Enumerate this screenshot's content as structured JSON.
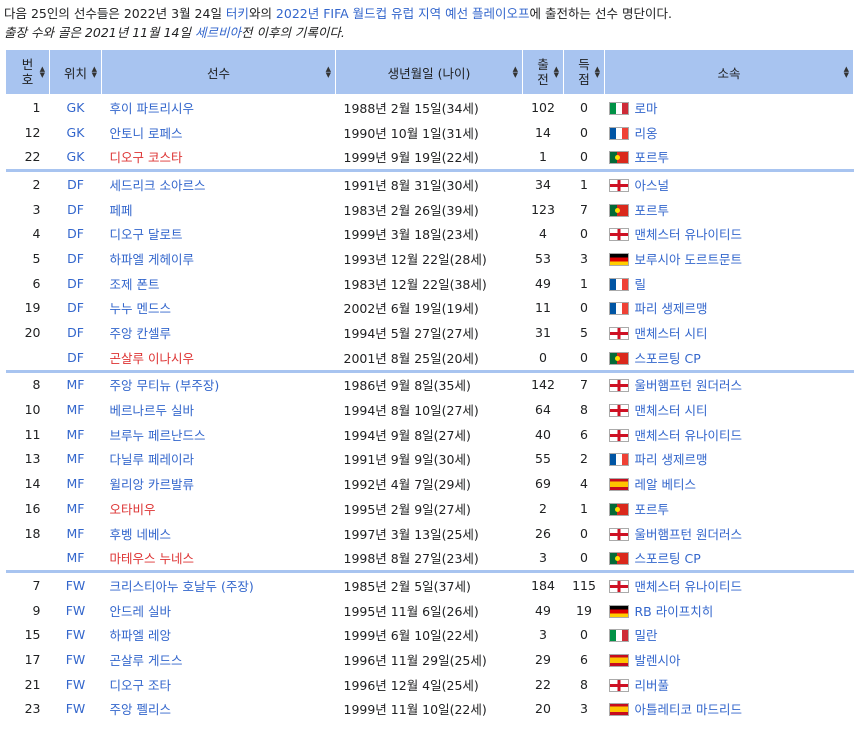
{
  "intro": {
    "p1_a": "다음 25인의 선수들은 2022년 3월 24일 ",
    "p1_link1": "터키",
    "p1_b": "와의 ",
    "p1_link2": "2022년 FIFA 월드컵 유럽 지역 예선 플레이오프",
    "p1_c": "에 출전하는 선수 명단이다.",
    "p2_a": "출장 수와 골은 2021년 11월 14일 ",
    "p2_link": "세르비아",
    "p2_b": "전 이후의 기록이다."
  },
  "headers": {
    "num": "번호",
    "pos": "위치",
    "player": "선수",
    "dob": "생년월일 (나이)",
    "caps": "출전",
    "goals": "득점",
    "club": "소속"
  },
  "icons": {
    "sort": "sort-icon",
    "flags": {
      "it": "italy-flag-icon",
      "fr": "france-flag-icon",
      "pt": "portugal-flag-icon",
      "en": "england-flag-icon",
      "de": "germany-flag-icon",
      "es": "spain-flag-icon"
    }
  },
  "colors": {
    "header_bg": "#a8c4f0",
    "link": "#3366cc",
    "redlink": "#dd3333"
  },
  "players": [
    {
      "num": "1",
      "pos": "GK",
      "name": "후이 파트리시우",
      "red": false,
      "dob": "1988년 2월 15일(34세)",
      "caps": "102",
      "goals": "0",
      "flag": "it",
      "club": "로마",
      "grp": true
    },
    {
      "num": "12",
      "pos": "GK",
      "name": "안토니 로페스",
      "red": false,
      "dob": "1990년 10월 1일(31세)",
      "caps": "14",
      "goals": "0",
      "flag": "fr",
      "club": "리옹",
      "grp": false
    },
    {
      "num": "22",
      "pos": "GK",
      "name": "디오구 코스타",
      "red": true,
      "dob": "1999년 9월 19일(22세)",
      "caps": "1",
      "goals": "0",
      "flag": "pt",
      "club": "포르투",
      "grp": false
    },
    {
      "num": "2",
      "pos": "DF",
      "name": "세드리크 소아르스",
      "red": false,
      "dob": "1991년 8월 31일(30세)",
      "caps": "34",
      "goals": "1",
      "flag": "en",
      "club": "아스널",
      "grp": true
    },
    {
      "num": "3",
      "pos": "DF",
      "name": "페페",
      "red": false,
      "dob": "1983년 2월 26일(39세)",
      "caps": "123",
      "goals": "7",
      "flag": "pt",
      "club": "포르투",
      "grp": false
    },
    {
      "num": "4",
      "pos": "DF",
      "name": "디오구 달로트",
      "red": false,
      "dob": "1999년 3월 18일(23세)",
      "caps": "4",
      "goals": "0",
      "flag": "en",
      "club": "맨체스터 유나이티드",
      "grp": false
    },
    {
      "num": "5",
      "pos": "DF",
      "name": "하파엘 게헤이루",
      "red": false,
      "dob": "1993년 12월 22일(28세)",
      "caps": "53",
      "goals": "3",
      "flag": "de",
      "club": "보루시아 도르트문트",
      "grp": false
    },
    {
      "num": "6",
      "pos": "DF",
      "name": "조제 폰트",
      "red": false,
      "dob": "1983년 12월 22일(38세)",
      "caps": "49",
      "goals": "1",
      "flag": "fr",
      "club": "릴",
      "grp": false
    },
    {
      "num": "19",
      "pos": "DF",
      "name": "누누 멘드스",
      "red": false,
      "dob": "2002년 6월 19일(19세)",
      "caps": "11",
      "goals": "0",
      "flag": "fr",
      "club": "파리 생제르맹",
      "grp": false
    },
    {
      "num": "20",
      "pos": "DF",
      "name": "주앙 칸셀루",
      "red": false,
      "dob": "1994년 5월 27일(27세)",
      "caps": "31",
      "goals": "5",
      "flag": "en",
      "club": "맨체스터 시티",
      "grp": false
    },
    {
      "num": "",
      "pos": "DF",
      "name": "곤살루 이나시우",
      "red": true,
      "dob": "2001년 8월 25일(20세)",
      "caps": "0",
      "goals": "0",
      "flag": "pt",
      "club": "스포르팅 CP",
      "grp": false
    },
    {
      "num": "8",
      "pos": "MF",
      "name": "주앙 무티뉴 (부주장)",
      "red": false,
      "dob": "1986년 9월 8일(35세)",
      "caps": "142",
      "goals": "7",
      "flag": "en",
      "club": "울버햄프턴 원더러스",
      "grp": true
    },
    {
      "num": "10",
      "pos": "MF",
      "name": "베르나르두 실바",
      "red": false,
      "dob": "1994년 8월 10일(27세)",
      "caps": "64",
      "goals": "8",
      "flag": "en",
      "club": "맨체스터 시티",
      "grp": false
    },
    {
      "num": "11",
      "pos": "MF",
      "name": "브루누 페르난드스",
      "red": false,
      "dob": "1994년 9월 8일(27세)",
      "caps": "40",
      "goals": "6",
      "flag": "en",
      "club": "맨체스터 유나이티드",
      "grp": false
    },
    {
      "num": "13",
      "pos": "MF",
      "name": "다닐루 페레이라",
      "red": false,
      "dob": "1991년 9월 9일(30세)",
      "caps": "55",
      "goals": "2",
      "flag": "fr",
      "club": "파리 생제르맹",
      "grp": false
    },
    {
      "num": "14",
      "pos": "MF",
      "name": "윌리앙 카르발류",
      "red": false,
      "dob": "1992년 4월 7일(29세)",
      "caps": "69",
      "goals": "4",
      "flag": "es",
      "club": "레알 베티스",
      "grp": false
    },
    {
      "num": "16",
      "pos": "MF",
      "name": "오타비우",
      "red": true,
      "dob": "1995년 2월 9일(27세)",
      "caps": "2",
      "goals": "1",
      "flag": "pt",
      "club": "포르투",
      "grp": false
    },
    {
      "num": "18",
      "pos": "MF",
      "name": "후벵 네베스",
      "red": false,
      "dob": "1997년 3월 13일(25세)",
      "caps": "26",
      "goals": "0",
      "flag": "en",
      "club": "울버햄프턴 원더러스",
      "grp": false
    },
    {
      "num": "",
      "pos": "MF",
      "name": "마테우스 누네스",
      "red": true,
      "dob": "1998년 8월 27일(23세)",
      "caps": "3",
      "goals": "0",
      "flag": "pt",
      "club": "스포르팅 CP",
      "grp": false
    },
    {
      "num": "7",
      "pos": "FW",
      "name": "크리스티아누 호날두 (주장)",
      "red": false,
      "dob": "1985년 2월 5일(37세)",
      "caps": "184",
      "goals": "115",
      "flag": "en",
      "club": "맨체스터 유나이티드",
      "grp": true
    },
    {
      "num": "9",
      "pos": "FW",
      "name": "안드레 실바",
      "red": false,
      "dob": "1995년 11월 6일(26세)",
      "caps": "49",
      "goals": "19",
      "flag": "de",
      "club": "RB 라이프치히",
      "grp": false
    },
    {
      "num": "15",
      "pos": "FW",
      "name": "하파엘 레앙",
      "red": false,
      "dob": "1999년 6월 10일(22세)",
      "caps": "3",
      "goals": "0",
      "flag": "it",
      "club": "밀란",
      "grp": false
    },
    {
      "num": "17",
      "pos": "FW",
      "name": "곤살루 게드스",
      "red": false,
      "dob": "1996년 11월 29일(25세)",
      "caps": "29",
      "goals": "6",
      "flag": "es",
      "club": "발렌시아",
      "grp": false
    },
    {
      "num": "21",
      "pos": "FW",
      "name": "디오구 조타",
      "red": false,
      "dob": "1996년 12월 4일(25세)",
      "caps": "22",
      "goals": "8",
      "flag": "en",
      "club": "리버풀",
      "grp": false
    },
    {
      "num": "23",
      "pos": "FW",
      "name": "주앙 펠리스",
      "red": false,
      "dob": "1999년 11월 10일(22세)",
      "caps": "20",
      "goals": "3",
      "flag": "es",
      "club": "아틀레티코 마드리드",
      "grp": false
    }
  ]
}
